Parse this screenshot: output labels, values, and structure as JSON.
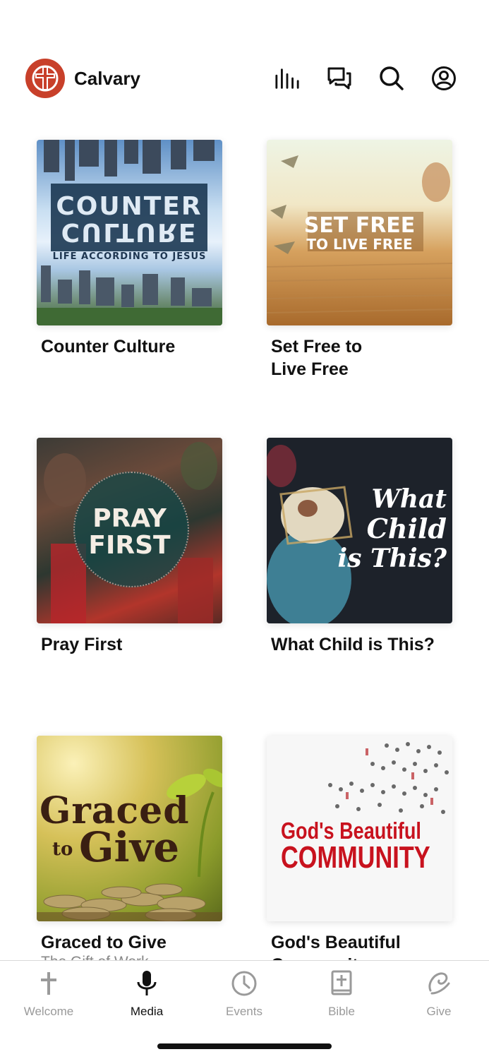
{
  "header": {
    "title": "Calvary",
    "icons": [
      "audio-bars-icon",
      "chat-icon",
      "search-icon",
      "account-icon"
    ],
    "logo_color": "#c8402a"
  },
  "cards": [
    {
      "title": "Counter Culture",
      "art": {
        "line1": "COUNTER",
        "line2": "CULTURE",
        "sub": "LIFE ACCORDING TO JESUS"
      }
    },
    {
      "title": "Set Free to\nLive Free",
      "art": {
        "line1": "SET FREE",
        "line2": "TO LIVE FREE"
      }
    },
    {
      "title": "Pray First",
      "art": {
        "line1": "PRAY",
        "line2": "FIRST"
      }
    },
    {
      "title": "What Child is This?",
      "art": {
        "line1": "What",
        "line2": "Child",
        "line3": "is This?"
      }
    },
    {
      "title": "Graced to Give",
      "subtitle": "The Gift of Work",
      "art": {
        "line1": "Graced",
        "line2": "to",
        "line3": "Give"
      }
    },
    {
      "title": "God's Beautiful\nCommunity",
      "art": {
        "line1": "God's Beautiful",
        "line2": "COMMUNITY"
      }
    }
  ],
  "tabs": [
    {
      "label": "Welcome",
      "icon": "cross-icon",
      "active": false
    },
    {
      "label": "Media",
      "icon": "microphone-icon",
      "active": true
    },
    {
      "label": "Events",
      "icon": "clock-icon",
      "active": false
    },
    {
      "label": "Bible",
      "icon": "bible-icon",
      "active": false
    },
    {
      "label": "Give",
      "icon": "give-icon",
      "active": false
    }
  ],
  "colors": {
    "active_tab": "#111111",
    "inactive_tab": "#9a9a9a",
    "brand": "#c8402a"
  }
}
